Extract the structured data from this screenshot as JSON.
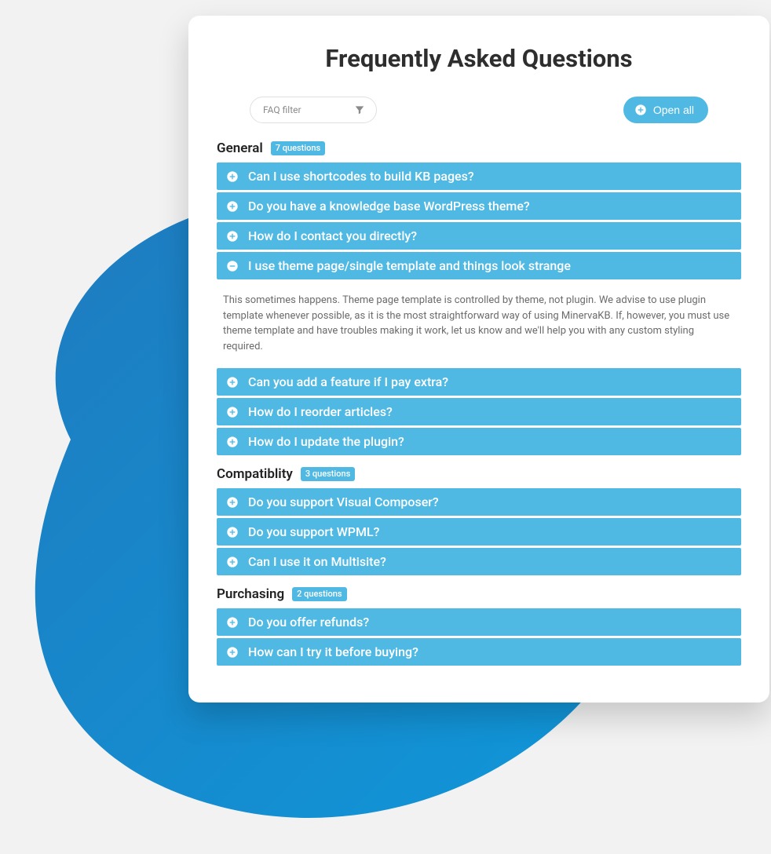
{
  "page_title": "Frequently Asked Questions",
  "toolbar": {
    "filter_label": "FAQ filter",
    "open_all_label": "Open all"
  },
  "sections": [
    {
      "name": "General",
      "badge": "7 questions",
      "items": [
        {
          "q": "Can I use shortcodes to build KB pages?",
          "open": false
        },
        {
          "q": "Do you have a knowledge base WordPress theme?",
          "open": false
        },
        {
          "q": "How do I contact you directly?",
          "open": false
        },
        {
          "q": "I use theme page/single template and things look strange",
          "open": true,
          "a": "This sometimes happens. Theme page template is controlled by theme, not plugin. We advise to use plugin template whenever possible, as it is the most straightforward way of using MinervaKB. If, however, you must use theme template and have troubles making it work, let us know and we'll help you with any custom styling required."
        },
        {
          "q": "Can you add a feature if I pay extra?",
          "open": false
        },
        {
          "q": "How do I reorder articles?",
          "open": false
        },
        {
          "q": "How do I update the plugin?",
          "open": false
        }
      ]
    },
    {
      "name": "Compatiblity",
      "badge": "3 questions",
      "items": [
        {
          "q": "Do you support Visual Composer?",
          "open": false
        },
        {
          "q": "Do you support WPML?",
          "open": false
        },
        {
          "q": "Can I use it on Multisite?",
          "open": false
        }
      ]
    },
    {
      "name": "Purchasing",
      "badge": "2 questions",
      "items": [
        {
          "q": "Do you offer refunds?",
          "open": false
        },
        {
          "q": "How can I try it before buying?",
          "open": false
        }
      ]
    }
  ],
  "colors": {
    "accent": "#4fb9e3",
    "blob_start": "#1f7bbf",
    "blob_end": "#2196d4"
  }
}
